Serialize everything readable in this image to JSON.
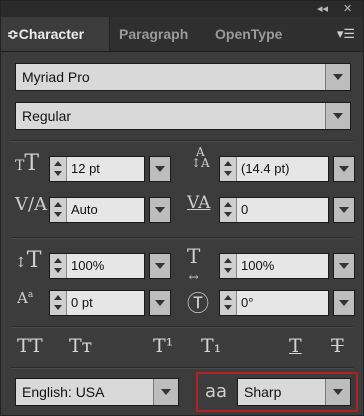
{
  "topbar": {
    "collapse_icon": "collapse-double-arrow-icon",
    "close_icon": "close-icon",
    "collapse_text": "◂◂",
    "close_text": "✕"
  },
  "tabs": [
    {
      "label": "Character",
      "active": true
    },
    {
      "label": "Paragraph",
      "active": false
    },
    {
      "label": "OpenType",
      "active": false
    }
  ],
  "tab_prefix": "≎",
  "panel_menu_icon": "panel-menu-icon",
  "font_family": {
    "value": "Myriad Pro"
  },
  "font_style": {
    "value": "Regular"
  },
  "fields": {
    "font_size": {
      "value": "12 pt",
      "icon": "font-size-icon"
    },
    "leading": {
      "value": "(14.4 pt)",
      "icon": "leading-icon"
    },
    "kerning": {
      "value": "Auto",
      "icon": "kerning-icon"
    },
    "tracking": {
      "value": "0",
      "icon": "tracking-icon"
    },
    "vertical_scale": {
      "value": "100%",
      "icon": "vertical-scale-icon"
    },
    "horizontal_scale": {
      "value": "100%",
      "icon": "horizontal-scale-icon"
    },
    "baseline_shift": {
      "value": "0 pt",
      "icon": "baseline-shift-icon"
    },
    "rotation": {
      "value": "0°",
      "icon": "character-rotation-icon"
    }
  },
  "format_buttons": [
    {
      "name": "all-caps-button",
      "glyph": "TT"
    },
    {
      "name": "small-caps-button",
      "glyph": "Tт"
    },
    {
      "name": "superscript-button",
      "glyph": "T¹"
    },
    {
      "name": "subscript-button",
      "glyph": "T₁"
    },
    {
      "name": "underline-button",
      "glyph": "T"
    },
    {
      "name": "strikethrough-button",
      "glyph": "T"
    }
  ],
  "language": {
    "value": "English: USA"
  },
  "antialias": {
    "value": "Sharp",
    "icon": "anti-aliasing-icon",
    "icon_text": "aa"
  },
  "colors": {
    "panel": "#3c3c3c",
    "field": "#e6e6e6",
    "highlight_box": "#b22222"
  }
}
